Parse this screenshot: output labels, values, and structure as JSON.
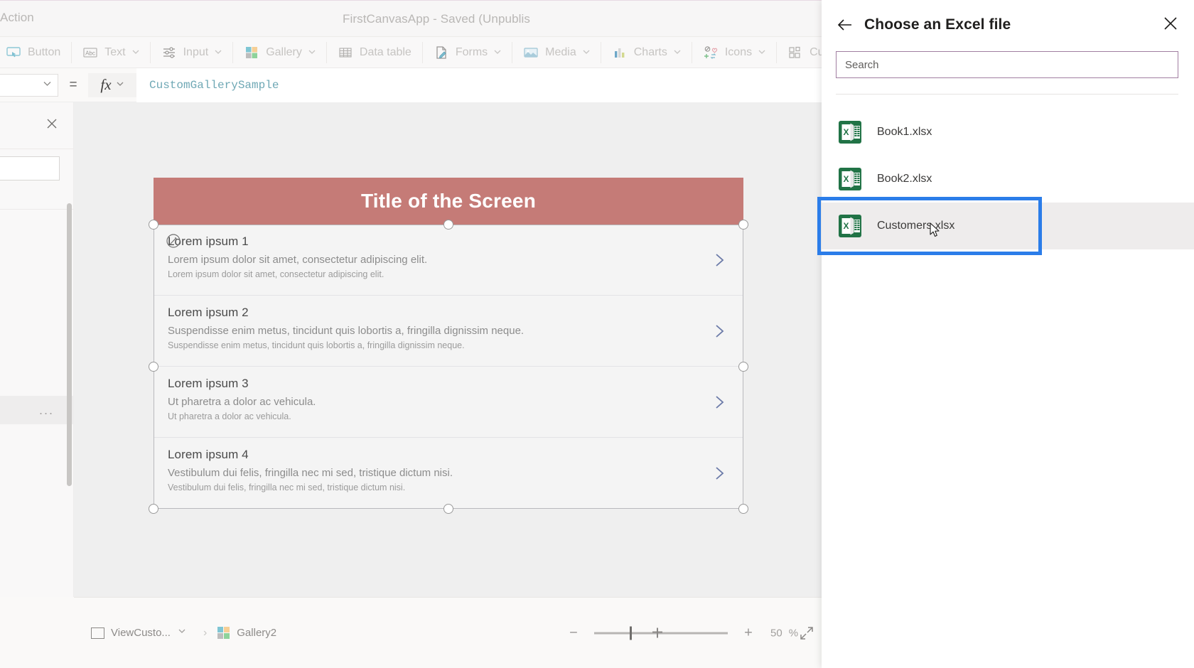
{
  "titlebar": {
    "left_label": "Action",
    "app_title": "FirstCanvasApp - Saved (Unpublis"
  },
  "ribbon": {
    "items": [
      {
        "label": "Button",
        "icon": "button-icon",
        "has_chevron": false
      },
      {
        "label": "Text",
        "icon": "text-abc-icon",
        "has_chevron": true
      },
      {
        "label": "Input",
        "icon": "input-sliders-icon",
        "has_chevron": true
      },
      {
        "label": "Gallery",
        "icon": "gallery-tiles-icon",
        "has_chevron": true
      },
      {
        "label": "Data table",
        "icon": "data-table-icon",
        "has_chevron": false
      },
      {
        "label": "Forms",
        "icon": "forms-icon",
        "has_chevron": true
      },
      {
        "label": "Media",
        "icon": "media-image-icon",
        "has_chevron": true
      },
      {
        "label": "Charts",
        "icon": "charts-bar-icon",
        "has_chevron": true
      },
      {
        "label": "Icons",
        "icon": "icons-shapes-icon",
        "has_chevron": true
      },
      {
        "label": "Cust",
        "icon": "custom-components-icon",
        "has_chevron": false
      }
    ]
  },
  "formula_bar": {
    "property_value": "",
    "equals": "=",
    "fx_label": "fx",
    "formula": "CustomGallerySample"
  },
  "left_panel": {
    "close_icon": "close-icon",
    "search_value": "",
    "overflow_label": "..."
  },
  "canvas": {
    "screen_title": "Title of the Screen",
    "gallery_items": [
      {
        "title": "Lorem ipsum 1",
        "subtitle": "Lorem ipsum dolor sit amet, consectetur adipiscing elit.",
        "detail": "Lorem ipsum dolor sit amet, consectetur adipiscing elit."
      },
      {
        "title": "Lorem ipsum 2",
        "subtitle": "Suspendisse enim metus, tincidunt quis lobortis a, fringilla dignissim neque.",
        "detail": "Suspendisse enim metus, tincidunt quis lobortis a, fringilla dignissim neque."
      },
      {
        "title": "Lorem ipsum 3",
        "subtitle": "Ut pharetra a dolor ac vehicula.",
        "detail": "Ut pharetra a dolor ac vehicula."
      },
      {
        "title": "Lorem ipsum 4",
        "subtitle": "Vestibulum dui felis, fringilla nec mi sed, tristique dictum nisi.",
        "detail": "Vestibulum dui felis, fringilla nec mi sed, tristique dictum nisi."
      }
    ],
    "chevron_icon": "chevron-right-icon",
    "edit_badge_icon": "edit-pencil-icon"
  },
  "statusbar": {
    "screen_name": "ViewCusto...",
    "control_name": "Gallery2",
    "zoom_out": "−",
    "zoom_in": "+",
    "zoom_value": "50",
    "zoom_unit": "%",
    "fit_icon": "fit-to-screen-icon"
  },
  "flyout": {
    "back_icon": "back-arrow-icon",
    "title": "Choose an Excel file",
    "close_icon": "close-icon",
    "search_placeholder": "Search",
    "search_value": "",
    "files": [
      {
        "name": "Book1.xlsx",
        "icon": "excel-file-icon",
        "selected": false
      },
      {
        "name": "Book2.xlsx",
        "icon": "excel-file-icon",
        "selected": false
      },
      {
        "name": "Customers.xlsx",
        "icon": "excel-file-icon",
        "selected": true
      }
    ]
  },
  "colors": {
    "accent_blue": "#2b7de9",
    "excel_green": "#217346",
    "screen_header": "#c57b77",
    "chevron": "#6b7aa8",
    "search_border": "#a17ea1"
  }
}
